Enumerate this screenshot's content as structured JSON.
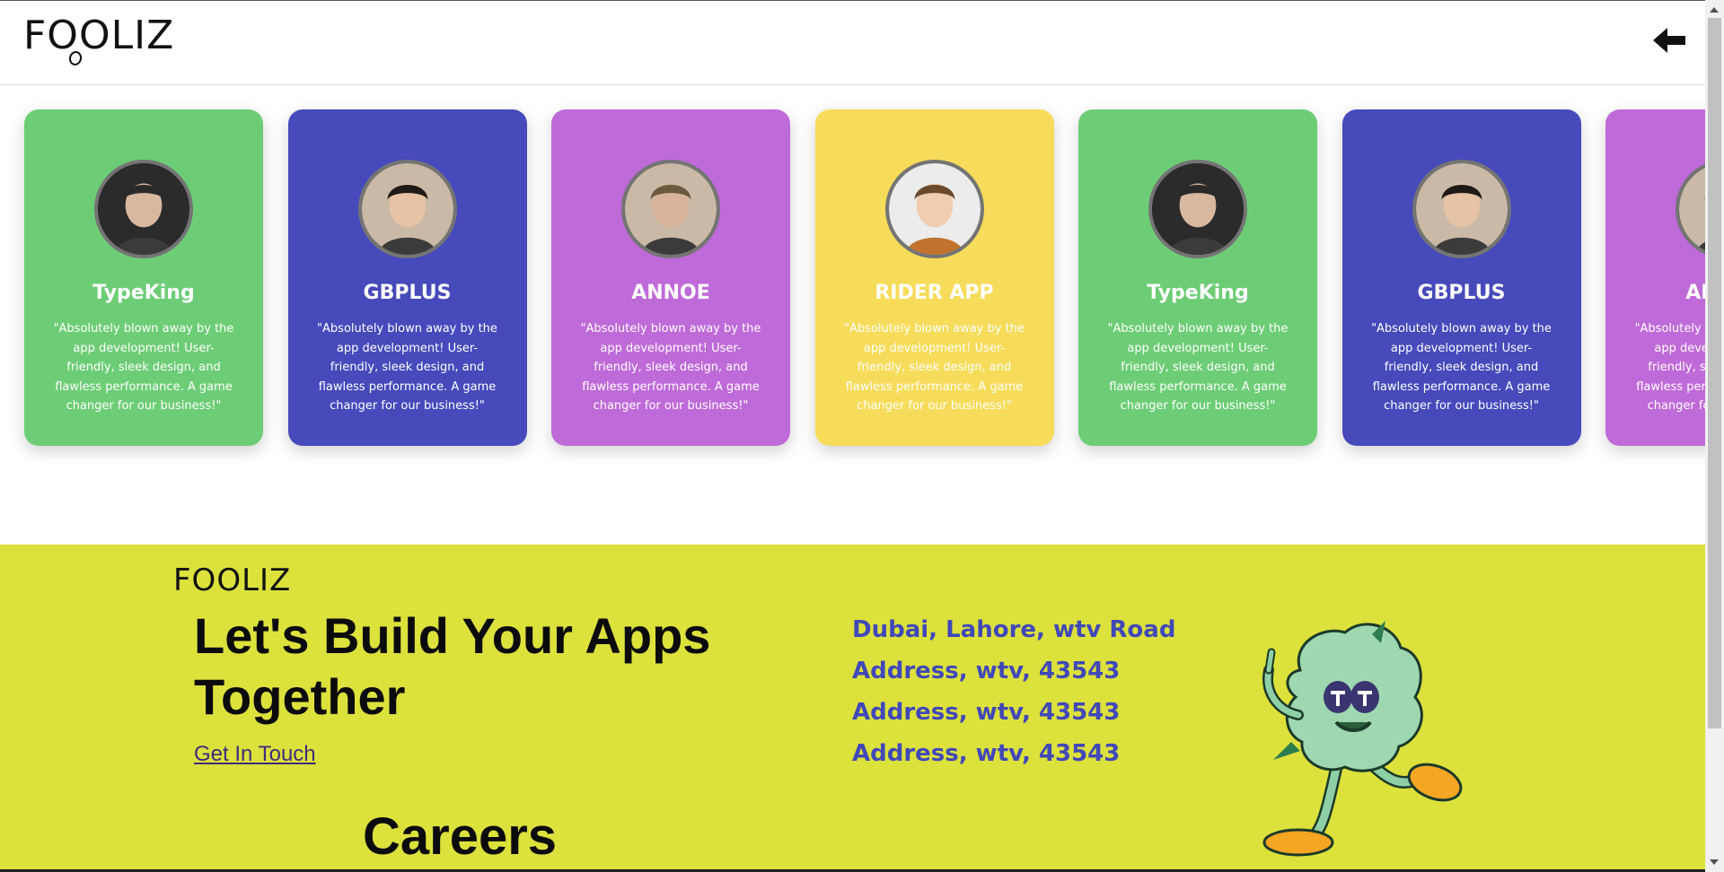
{
  "header": {
    "logo_text": "FOOLIZ",
    "back_icon": "arrow-left-icon"
  },
  "testimonials": [
    {
      "name": "TypeKing",
      "quote": "\"Absolutely blown away by the app development! User-friendly, sleek design, and flawless performance. A game changer for our business!\"",
      "color": "#6dcd76",
      "avatar_icon": "person-avatar"
    },
    {
      "name": "GBPLUS",
      "quote": "\"Absolutely blown away by the app development! User-friendly, sleek design, and flawless performance. A game changer for our business!\"",
      "color": "#464abb",
      "avatar_icon": "person-avatar"
    },
    {
      "name": "ANNOE",
      "quote": "\"Absolutely blown away by the app development! User-friendly, sleek design, and flawless performance. A game changer for our business!\"",
      "color": "#bf6ad9",
      "avatar_icon": "person-avatar"
    },
    {
      "name": "RIDER APP",
      "quote": "\"Absolutely blown away by the app development! User-friendly, sleek design, and flawless performance. A game changer for our business!\"",
      "color": "#f6dc5a",
      "avatar_icon": "person-avatar"
    },
    {
      "name": "TypeKing",
      "quote": "\"Absolutely blown away by the app development! User-friendly, sleek design, and flawless performance. A game changer for our business!\"",
      "color": "#6dcd76",
      "avatar_icon": "person-avatar"
    },
    {
      "name": "GBPLUS",
      "quote": "\"Absolutely blown away by the app development! User-friendly, sleek design, and flawless performance. A game changer for our business!\"",
      "color": "#464abb",
      "avatar_icon": "person-avatar"
    },
    {
      "name": "ANNOE",
      "quote": "\"Absolutely blown away by the app development! User-friendly, sleek design, and flawless performance. A game changer for our business!\"",
      "color": "#bf6ad9",
      "avatar_icon": "person-avatar"
    }
  ],
  "footer": {
    "logo_text": "FOOLIZ",
    "headline": "Let's Build Your Apps Together",
    "cta_label": "Get In Touch",
    "careers_label": "Careers",
    "addresses": [
      "Dubai, Lahore, wtv Road",
      "Address, wtv, 43543",
      "Address, wtv, 43543",
      "Address, wtv, 43543"
    ],
    "background_color": "#dce13c",
    "address_color": "#4148b8",
    "mascot_icon": "mascot-illustration"
  }
}
